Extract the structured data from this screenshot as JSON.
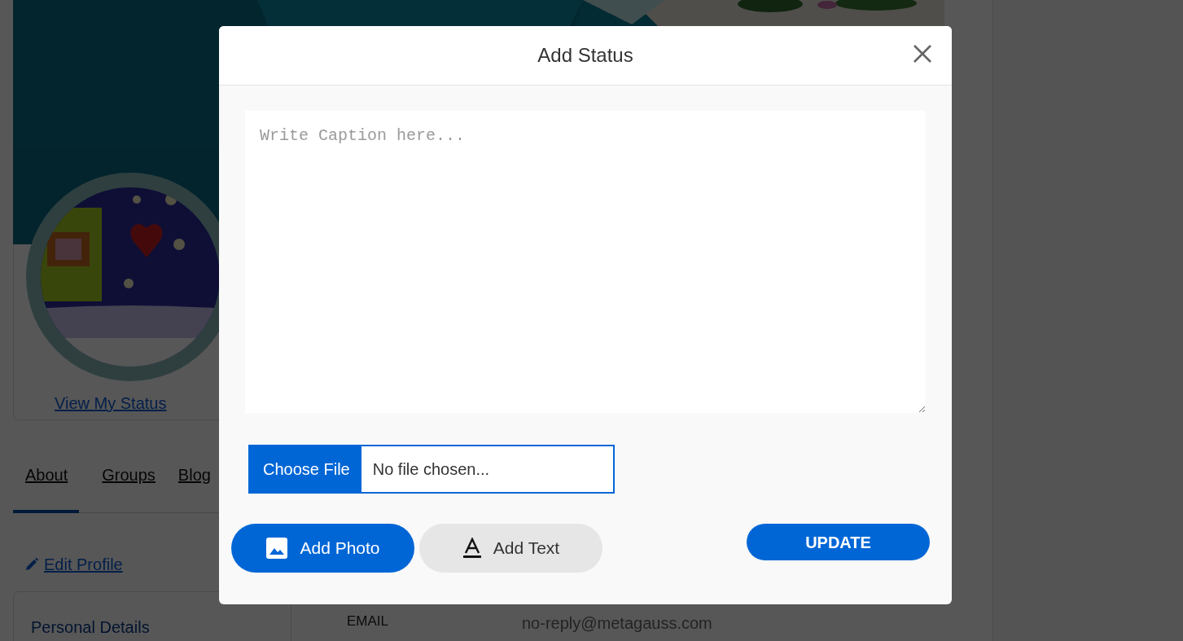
{
  "profile": {
    "status_link": "View My Status",
    "tabs": [
      {
        "label": "About",
        "selected": true
      },
      {
        "label": "Groups",
        "selected": false
      },
      {
        "label": "Blog",
        "selected": false
      }
    ],
    "edit_link": "Edit Profile",
    "section_title": "Personal Details",
    "fields": [
      {
        "label": "EMAIL",
        "value": "no-reply@metagauss.com"
      }
    ]
  },
  "modal": {
    "title": "Add Status",
    "caption": {
      "placeholder": "Write Caption here..."
    },
    "file": {
      "button": "Choose File",
      "value": "No file chosen..."
    },
    "actions": [
      {
        "label": "Add Photo",
        "selected": true
      },
      {
        "label": "Add Text",
        "kind": "text",
        "selected": false
      }
    ],
    "submit": "UPDATE"
  }
}
